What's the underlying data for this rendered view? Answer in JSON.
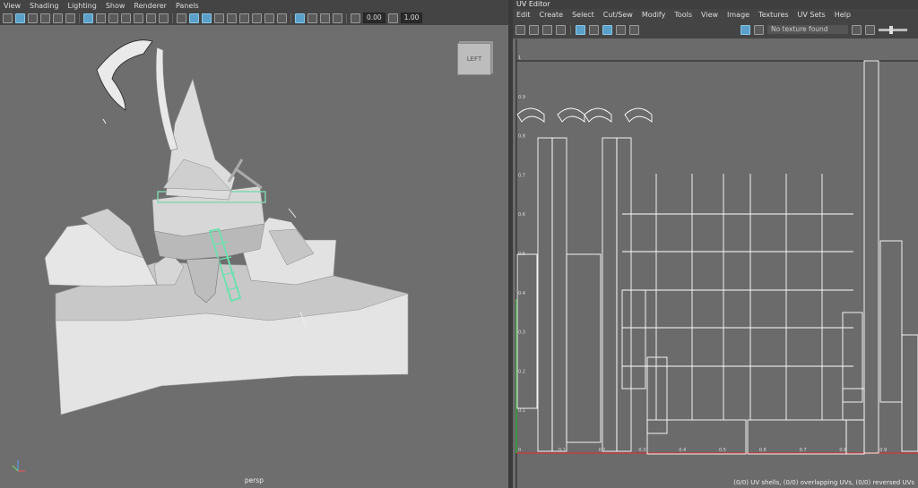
{
  "left_panel": {
    "menu": [
      "View",
      "Shading",
      "Lighting",
      "Show",
      "Renderer",
      "Panels"
    ],
    "fields": {
      "exposure": "0.00",
      "gamma": "1.00"
    },
    "view_cube_label": "LEFT",
    "camera_label": "persp"
  },
  "right_panel": {
    "title": "UV Editor",
    "menu": [
      "Edit",
      "Create",
      "Select",
      "Cut/Sew",
      "Modify",
      "Tools",
      "View",
      "Image",
      "Textures",
      "UV Sets",
      "Help"
    ],
    "texture_field": "No texture found",
    "status": "(0/0) UV shells, (0/0) overlapping UVs, (0/0) reversed UVs",
    "axis_labels_y": [
      "1",
      "0.9",
      "0.8",
      "0.7",
      "0.6",
      "0.5",
      "0.4",
      "0.3",
      "0.2",
      "0.1",
      "0"
    ],
    "axis_labels_x": [
      "0.1",
      "0.2",
      "0.3",
      "0.4",
      "0.5",
      "0.6",
      "0.7",
      "0.8",
      "0.9"
    ]
  },
  "colors": {
    "accent": "#5aa0c8",
    "ladder": "#6fe0b0",
    "uv_lines": "#ffffff"
  }
}
